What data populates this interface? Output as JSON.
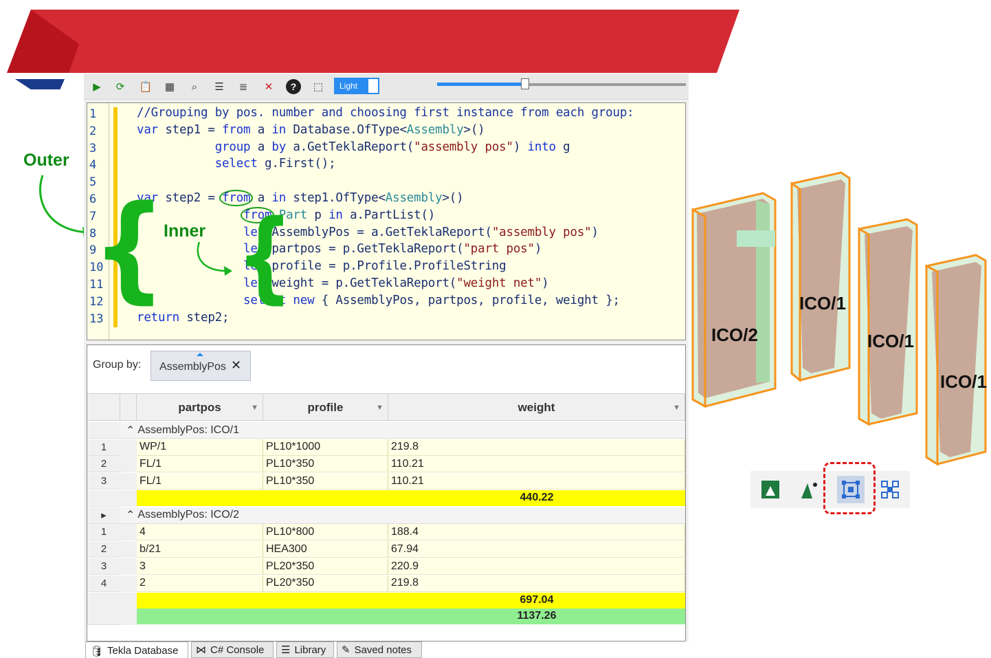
{
  "colors": {
    "accent": "#2a8cf0",
    "banner_red": "#d42a33",
    "banner_blue": "#1a3a8c",
    "annotation_green": "#18b41e",
    "highlight_yellow": "#ffff00",
    "total_green": "#90ee90",
    "selection_red": "#e01818",
    "assembly_orange": "#f7941d"
  },
  "toolbar": {
    "icons": [
      "run-icon",
      "refresh-icon",
      "clipboard-icon",
      "table-icon",
      "find-icon",
      "indent-icon",
      "format-icon",
      "filter-off-icon",
      "help-icon",
      "screen-select-icon"
    ],
    "theme_label": "Light",
    "slider_value": 0.35
  },
  "editor": {
    "line_numbers": [
      "1",
      "2",
      "3",
      "4",
      "5",
      "6",
      "7",
      "8",
      "9",
      "10",
      "11",
      "12",
      "13"
    ],
    "lines": [
      {
        "segments": [
          {
            "t": "//Grouping by pos. number and choosing first instance from each group:",
            "c": "cm"
          }
        ]
      },
      {
        "segments": [
          {
            "t": "var",
            "c": "kw"
          },
          {
            "t": " step1 = "
          },
          {
            "t": "from",
            "c": "kw"
          },
          {
            "t": " a "
          },
          {
            "t": "in",
            "c": "kw"
          },
          {
            "t": " Database.OfType<"
          },
          {
            "t": "Assembly",
            "c": "ty"
          },
          {
            "t": ">()"
          }
        ]
      },
      {
        "segments": [
          {
            "t": "           "
          },
          {
            "t": "group",
            "c": "kw"
          },
          {
            "t": " a "
          },
          {
            "t": "by",
            "c": "kw"
          },
          {
            "t": " a.GetTeklaReport("
          },
          {
            "t": "\"assembly pos\"",
            "c": "st"
          },
          {
            "t": ") "
          },
          {
            "t": "into",
            "c": "kw"
          },
          {
            "t": " g"
          }
        ]
      },
      {
        "segments": [
          {
            "t": "           "
          },
          {
            "t": "select",
            "c": "kw"
          },
          {
            "t": " g.First();"
          }
        ]
      },
      {
        "segments": []
      },
      {
        "segments": [
          {
            "t": "var",
            "c": "kw"
          },
          {
            "t": " step2 = "
          },
          {
            "t": "from",
            "c": "kw circ"
          },
          {
            "t": " a "
          },
          {
            "t": "in",
            "c": "kw"
          },
          {
            "t": " step1.OfType<"
          },
          {
            "t": "Assembly",
            "c": "ty"
          },
          {
            "t": ">()"
          }
        ]
      },
      {
        "segments": [
          {
            "t": "               "
          },
          {
            "t": "from",
            "c": "kw circ"
          },
          {
            "t": " "
          },
          {
            "t": "Part",
            "c": "ty"
          },
          {
            "t": " p "
          },
          {
            "t": "in",
            "c": "kw"
          },
          {
            "t": " a.PartList()"
          }
        ]
      },
      {
        "segments": [
          {
            "t": "               "
          },
          {
            "t": "let",
            "c": "kw"
          },
          {
            "t": " AssemblyPos = a.GetTeklaReport("
          },
          {
            "t": "\"assembly pos\"",
            "c": "st"
          },
          {
            "t": ")"
          }
        ]
      },
      {
        "segments": [
          {
            "t": "               "
          },
          {
            "t": "let",
            "c": "kw"
          },
          {
            "t": " partpos = p.GetTeklaReport("
          },
          {
            "t": "\"part pos\"",
            "c": "st"
          },
          {
            "t": ")"
          }
        ]
      },
      {
        "segments": [
          {
            "t": "               "
          },
          {
            "t": "let",
            "c": "kw"
          },
          {
            "t": " profile = p.Profile.ProfileString"
          }
        ]
      },
      {
        "segments": [
          {
            "t": "               "
          },
          {
            "t": "let",
            "c": "kw"
          },
          {
            "t": " weight = p.GetTeklaReport("
          },
          {
            "t": "\"weight net\"",
            "c": "st"
          },
          {
            "t": ")"
          }
        ]
      },
      {
        "segments": [
          {
            "t": "               "
          },
          {
            "t": "select",
            "c": "kw"
          },
          {
            "t": " "
          },
          {
            "t": "new",
            "c": "kw"
          },
          {
            "t": " { AssemblyPos, partpos, profile, weight };"
          }
        ]
      },
      {
        "segments": [
          {
            "t": "return",
            "c": "kw"
          },
          {
            "t": " step2;"
          }
        ]
      }
    ]
  },
  "annotations": {
    "outer": "Outer",
    "inner": "Inner"
  },
  "grid": {
    "group_by_label": "Group by:",
    "group_by_chip": "AssemblyPos",
    "columns": [
      "partpos",
      "profile",
      "weight"
    ],
    "groups": [
      {
        "title": "AssemblyPos: ICO/1",
        "rows": [
          [
            "1",
            "WP/1",
            "PL10*1000",
            "219.8"
          ],
          [
            "2",
            "FL/1",
            "PL10*350",
            "110.21"
          ],
          [
            "3",
            "FL/1",
            "PL10*350",
            "110.21"
          ]
        ],
        "subtotal": "440.22"
      },
      {
        "title": "AssemblyPos: ICO/2",
        "rows": [
          [
            "1",
            "4",
            "PL10*800",
            "188.4"
          ],
          [
            "2",
            "b/21",
            "HEA300",
            "67.94"
          ],
          [
            "3",
            "3",
            "PL20*350",
            "220.9"
          ],
          [
            "4",
            "2",
            "PL20*350",
            "219.8"
          ]
        ],
        "subtotal": "697.04"
      }
    ],
    "grand_total": "1137.26"
  },
  "tabs": [
    {
      "label": "Tekla Database",
      "icon": "database-icon",
      "active": true
    },
    {
      "label": "C# Console",
      "icon": "visual-studio-icon",
      "active": false
    },
    {
      "label": "Library",
      "icon": "library-icon",
      "active": false
    },
    {
      "label": "Saved notes",
      "icon": "pen-icon",
      "active": false
    }
  ],
  "assemblies": [
    {
      "label": "ICO/2"
    },
    {
      "label": "ICO/1"
    },
    {
      "label": "ICO/1"
    },
    {
      "label": "ICO/1"
    }
  ],
  "view_toolbar": {
    "icons": [
      "part-view-icon",
      "part-point-icon",
      "assembly-bbox-icon",
      "assembly-nodes-icon"
    ],
    "selected": "assembly-bbox-icon"
  }
}
